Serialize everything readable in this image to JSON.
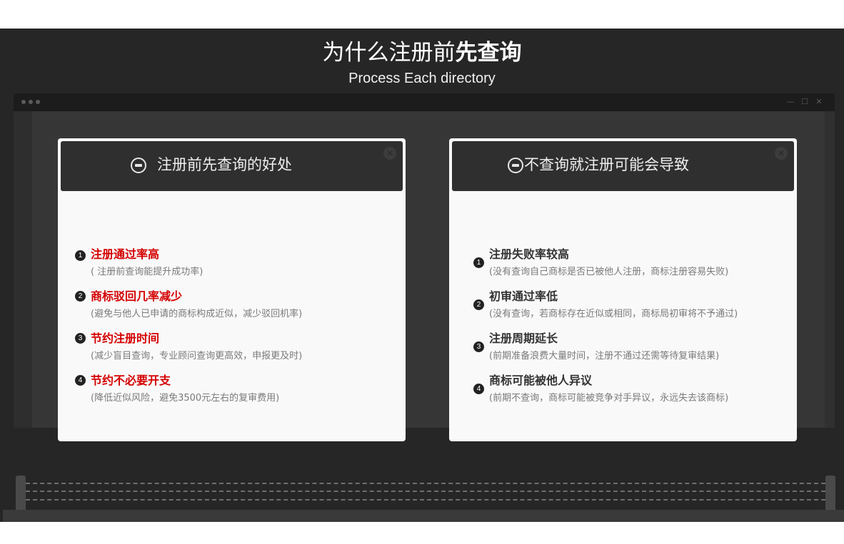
{
  "header": {
    "title_normal": "为什么注册前",
    "title_bold": "先查询",
    "subtitle": "Process Each directory"
  },
  "browser": {
    "window_controls": [
      "—",
      "☐",
      "✕"
    ]
  },
  "left_card": {
    "title": "注册前先查询的好处",
    "items": [
      {
        "num": "1",
        "title": "注册通过率高",
        "desc": "( 注册前查询能提升成功率)"
      },
      {
        "num": "2",
        "title": "商标驳回几率减少",
        "desc": "(避免与他人已申请的商标构成近似，减少驳回机率)"
      },
      {
        "num": "3",
        "title": "节约注册时间",
        "desc": "(减少盲目查询，专业顾问查询更高效，申报更及时)"
      },
      {
        "num": "4",
        "title": "节约不必要开支",
        "desc": "(降低近似风险，避免3500元左右的复审费用)"
      }
    ]
  },
  "right_card": {
    "title": "不查询就注册可能会导致",
    "items": [
      {
        "num": "1",
        "title": "注册失败率较高",
        "desc": "(没有查询自己商标是否已被他人注册，商标注册容易失败)"
      },
      {
        "num": "2",
        "title": "初审通过率低",
        "desc": "(没有查询，若商标存在近似或相同，商标局初审将不予通过)"
      },
      {
        "num": "3",
        "title": "注册周期延长",
        "desc": "(前期准备浪费大量时间，注册不通过还需等待复审结果)"
      },
      {
        "num": "4",
        "title": "商标可能被他人异议",
        "desc": "(前期不查询，商标可能被竞争对手异议，永远失去该商标)"
      }
    ]
  },
  "colors": {
    "background": "#262626",
    "card": "#f9f9f9",
    "card_header": "#2f2f2f",
    "accent_red": "#d40000"
  }
}
